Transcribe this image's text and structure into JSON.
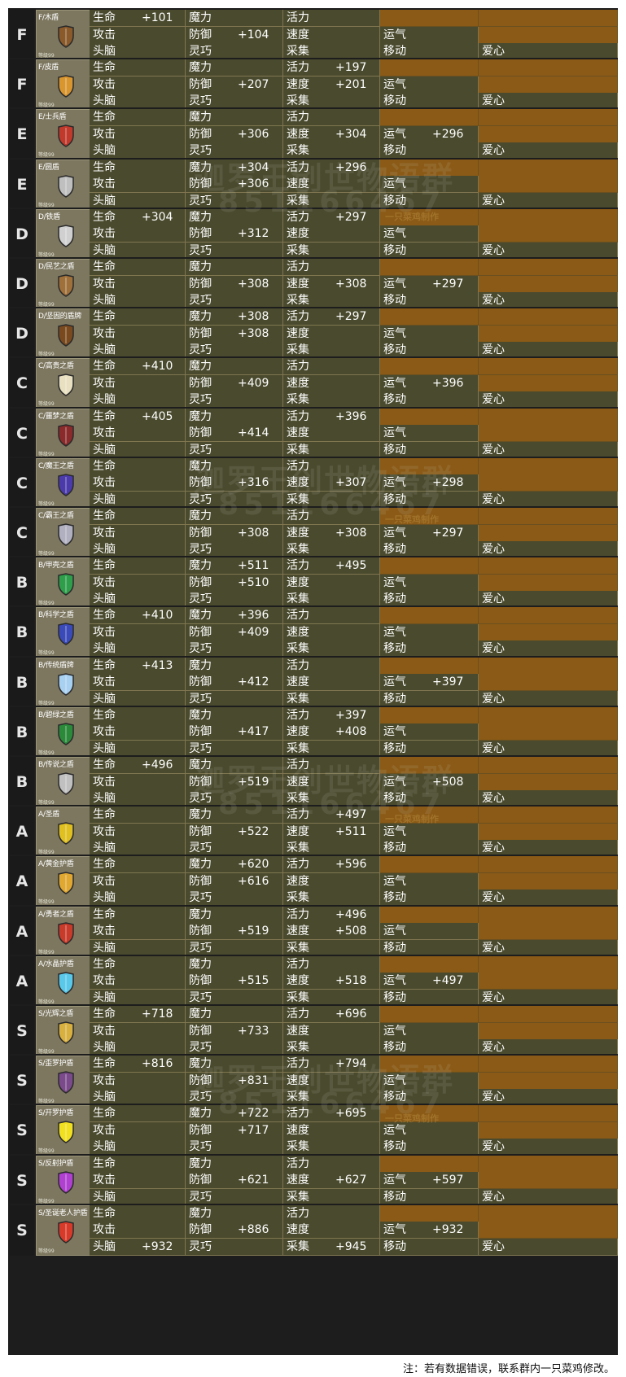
{
  "colors": {
    "frame": "#1d1d1d",
    "cell": "#4a4a2e",
    "orange": "#8a5a16",
    "thumb": "#7d7760"
  },
  "level_text": "等级99",
  "watermark": {
    "line1": "迦罗王创世物语群",
    "line2": "851166467",
    "credit": "一只菜鸡制作"
  },
  "footnote": "注：若有数据错误，联系群内一只菜鸡修改。",
  "shields": [
    {
      "grade": "F",
      "name": "F/木盾",
      "icon": "wood-shield-icon",
      "icon_color": "#8a5a2a",
      "stats": {
        "生命": "+101",
        "防御": "+104"
      }
    },
    {
      "grade": "F",
      "name": "F/皮盾",
      "icon": "leather-shield-icon",
      "icon_color": "#d9962f",
      "stats": {
        "活力": "+197",
        "防御": "+207",
        "速度": "+201"
      }
    },
    {
      "grade": "E",
      "name": "E/士兵盾",
      "icon": "soldier-shield-icon",
      "icon_color": "#c0392b",
      "stats": {
        "防御": "+306",
        "速度": "+304",
        "运气": "+296"
      }
    },
    {
      "grade": "E",
      "name": "E/圆盾",
      "icon": "round-shield-icon",
      "icon_color": "#bfbfbf",
      "stats": {
        "魔力": "+304",
        "活力": "+296",
        "防御": "+306"
      }
    },
    {
      "grade": "D",
      "name": "D/铁盾",
      "icon": "iron-shield-icon",
      "icon_color": "#d0d0d0",
      "stats": {
        "生命": "+304",
        "活力": "+297",
        "防御": "+312"
      }
    },
    {
      "grade": "D",
      "name": "D/民艺之盾",
      "icon": "folk-shield-icon",
      "icon_color": "#a0703a",
      "stats": {
        "防御": "+308",
        "速度": "+308",
        "运气": "+297"
      }
    },
    {
      "grade": "D",
      "name": "D/坚固的盾牌",
      "icon": "sturdy-shield-icon",
      "icon_color": "#7a4a1e",
      "stats": {
        "魔力": "+308",
        "活力": "+297",
        "防御": "+308"
      }
    },
    {
      "grade": "C",
      "name": "C/高贵之盾",
      "icon": "noble-shield-icon",
      "icon_color": "#e8e0c0",
      "stats": {
        "生命": "+410",
        "防御": "+409",
        "运气": "+396"
      }
    },
    {
      "grade": "C",
      "name": "C/噩梦之盾",
      "icon": "nightmare-shield-icon",
      "icon_color": "#8a2a2a",
      "stats": {
        "生命": "+405",
        "活力": "+396",
        "防御": "+414"
      }
    },
    {
      "grade": "C",
      "name": "C/魔王之盾",
      "icon": "demon-king-shield-icon",
      "icon_color": "#4a3aaa",
      "stats": {
        "防御": "+316",
        "速度": "+307",
        "运气": "+298"
      }
    },
    {
      "grade": "C",
      "name": "C/霸王之盾",
      "icon": "overlord-shield-icon",
      "icon_color": "#b0b0c0",
      "stats": {
        "防御": "+308",
        "速度": "+308",
        "运气": "+297"
      }
    },
    {
      "grade": "B",
      "name": "B/甲壳之盾",
      "icon": "carapace-shield-icon",
      "icon_color": "#2e9e4a",
      "stats": {
        "魔力": "+511",
        "活力": "+495",
        "防御": "+510"
      }
    },
    {
      "grade": "B",
      "name": "B/科学之盾",
      "icon": "science-shield-icon",
      "icon_color": "#3a4ab8",
      "stats": {
        "生命": "+410",
        "魔力": "+396",
        "防御": "+409"
      }
    },
    {
      "grade": "B",
      "name": "B/传统盾牌",
      "icon": "traditional-shield-icon",
      "icon_color": "#a8d0f0",
      "stats": {
        "生命": "+413",
        "防御": "+412",
        "运气": "+397"
      }
    },
    {
      "grade": "B",
      "name": "B/碧绿之盾",
      "icon": "emerald-shield-icon",
      "icon_color": "#2a8a3a",
      "stats": {
        "活力": "+397",
        "防御": "+417",
        "速度": "+408"
      }
    },
    {
      "grade": "B",
      "name": "B/传说之盾",
      "icon": "legend-shield-icon",
      "icon_color": "#c0c0c0",
      "stats": {
        "生命": "+496",
        "防御": "+519",
        "运气": "+508"
      }
    },
    {
      "grade": "A",
      "name": "A/圣盾",
      "icon": "holy-shield-icon",
      "icon_color": "#e0c020",
      "stats": {
        "活力": "+497",
        "防御": "+522",
        "速度": "+511"
      }
    },
    {
      "grade": "A",
      "name": "A/黄金护盾",
      "icon": "golden-shield-icon",
      "icon_color": "#e0a830",
      "stats": {
        "魔力": "+620",
        "活力": "+596",
        "防御": "+616"
      }
    },
    {
      "grade": "A",
      "name": "A/勇者之盾",
      "icon": "hero-shield-icon",
      "icon_color": "#c83a2a",
      "stats": {
        "活力": "+496",
        "防御": "+519",
        "速度": "+508"
      }
    },
    {
      "grade": "A",
      "name": "A/水晶护盾",
      "icon": "crystal-shield-icon",
      "icon_color": "#5ac8e8",
      "stats": {
        "防御": "+515",
        "速度": "+518",
        "运气": "+497"
      }
    },
    {
      "grade": "S",
      "name": "S/光辉之盾",
      "icon": "radiant-shield-icon",
      "icon_color": "#d8b040",
      "stats": {
        "生命": "+718",
        "活力": "+696",
        "防御": "+733"
      }
    },
    {
      "grade": "S",
      "name": "S/歪罗护盾",
      "icon": "cat-shield-icon",
      "icon_color": "#7a4a8a",
      "stats": {
        "生命": "+816",
        "活力": "+794",
        "防御": "+831"
      }
    },
    {
      "grade": "S",
      "name": "S/开罗护盾",
      "icon": "kairo-shield-icon",
      "icon_color": "#f0e020",
      "stats": {
        "魔力": "+722",
        "活力": "+695",
        "防御": "+717"
      }
    },
    {
      "grade": "S",
      "name": "S/反射护盾",
      "icon": "reflect-shield-icon",
      "icon_color": "#b040d0",
      "stats": {
        "防御": "+621",
        "速度": "+627",
        "运气": "+597"
      }
    },
    {
      "grade": "S",
      "name": "S/圣诞老人护盾",
      "icon": "santa-shield-icon",
      "icon_color": "#d83a2a",
      "stats": {
        "防御": "+886",
        "采集": "+945",
        "运气": "+932",
        "头脑": "+932"
      }
    }
  ],
  "layout": [
    [
      {
        "label": "生命"
      },
      {
        "label": "魔力"
      },
      {
        "label": "活力"
      },
      {
        "label": ""
      },
      {
        "label": ""
      }
    ],
    [
      {
        "label": "攻击"
      },
      {
        "label": "防御"
      },
      {
        "label": "速度"
      },
      {
        "label": "运气"
      },
      {
        "label": ""
      }
    ],
    [
      {
        "label": "头脑"
      },
      {
        "label": "灵巧"
      },
      {
        "label": "采集"
      },
      {
        "label": "移动"
      },
      {
        "label": "爱心"
      }
    ]
  ]
}
